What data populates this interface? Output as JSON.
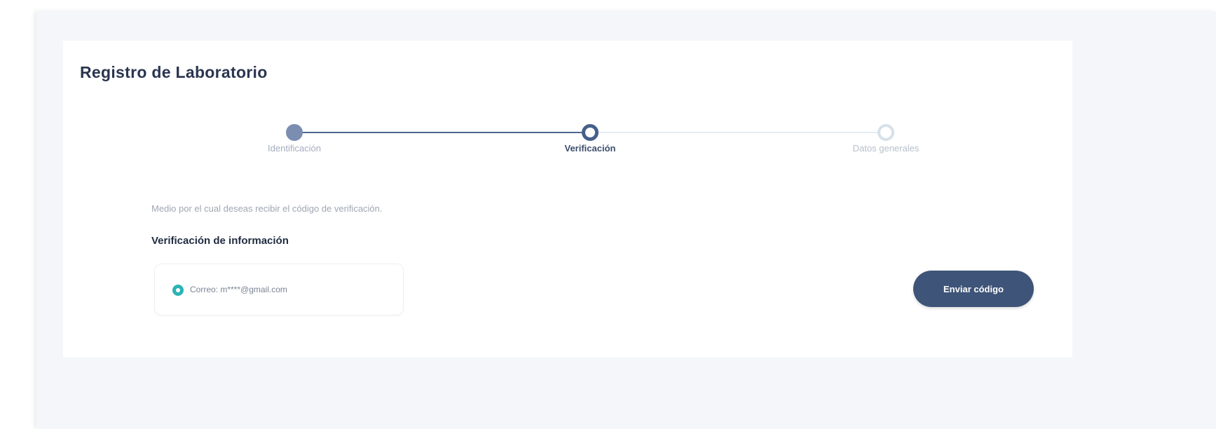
{
  "page": {
    "title": "Registro de Laboratorio"
  },
  "stepper": {
    "steps": [
      {
        "label": "Identificación",
        "state": "completed"
      },
      {
        "label": "Verificación",
        "state": "current"
      },
      {
        "label": "Datos generales",
        "state": "upcoming"
      }
    ]
  },
  "verification": {
    "hint": "Medio por el cual deseas recibir el código de verificación.",
    "section_title": "Verificación de información",
    "option": {
      "label": "Correo: m****@gmail.com",
      "selected": true
    },
    "send_button_label": "Enviar código"
  },
  "colors": {
    "primary": "#3e5478",
    "accent_radio": "#2bb3b5",
    "background": "#f4f6f9"
  }
}
